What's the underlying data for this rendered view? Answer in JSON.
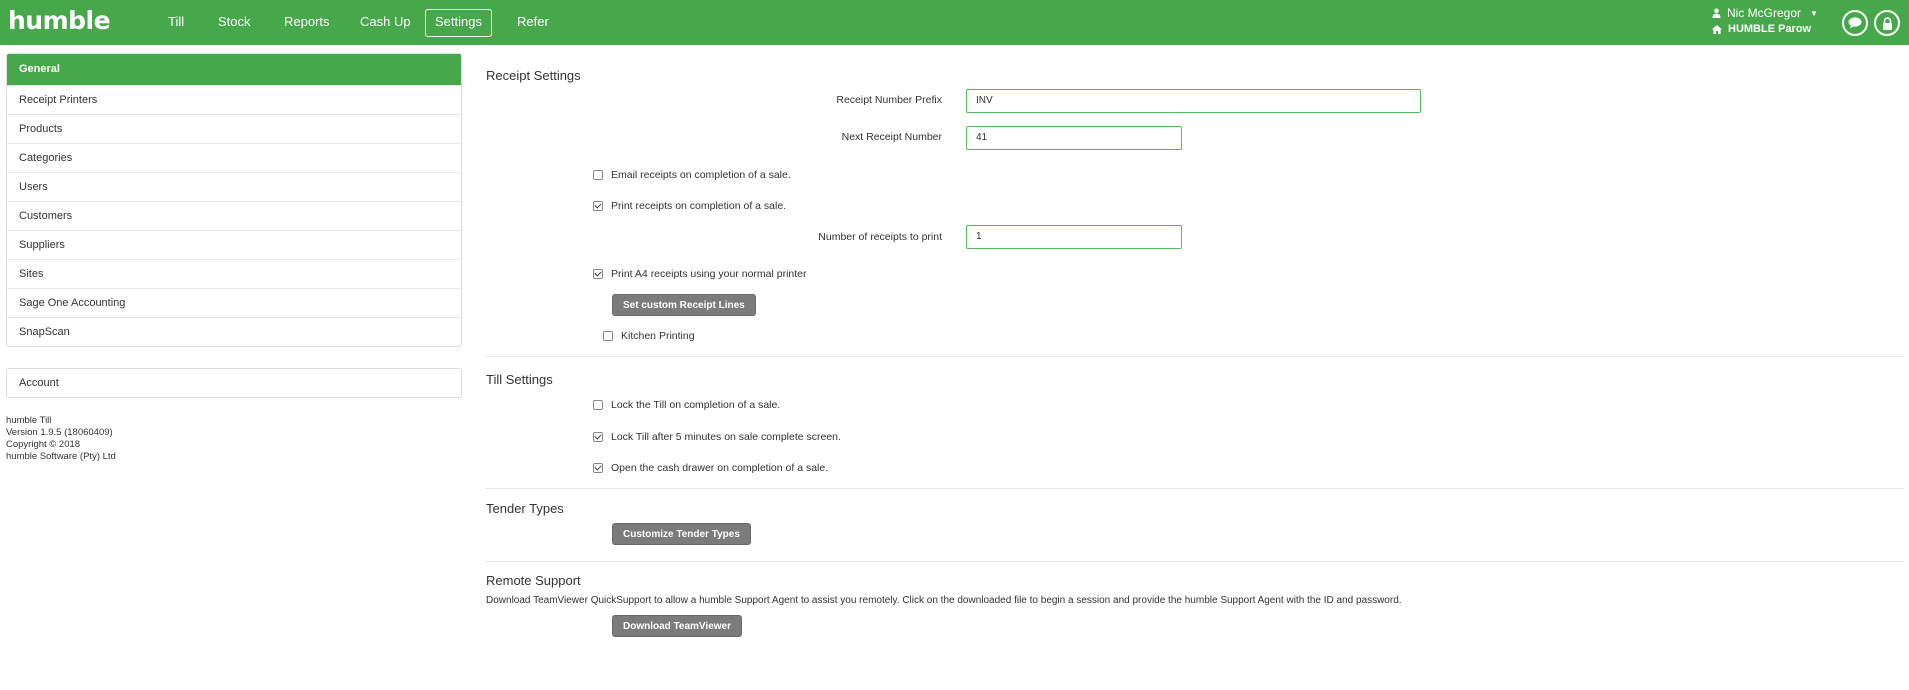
{
  "app": {
    "logo": "humble",
    "nav": [
      "Till",
      "Stock",
      "Reports",
      "Cash Up",
      "Settings",
      "Refer"
    ],
    "active_nav": "Settings",
    "user": {
      "name": "Nic McGregor",
      "site": "HUMBLE Parow"
    },
    "accent_color": "#46a84b"
  },
  "sidebar": {
    "items": [
      "General",
      "Receipt Printers",
      "Products",
      "Categories",
      "Users",
      "Customers",
      "Suppliers",
      "Sites",
      "Sage One Accounting",
      "SnapScan"
    ],
    "active": "General",
    "account": "Account",
    "info": [
      "humble Till",
      "Version 1.9.5 (18060409)",
      "Copyright © 2018",
      "humble Software (Pty) Ltd"
    ]
  },
  "receipt_settings": {
    "title": "Receipt Settings",
    "prefix_label": "Receipt Number Prefix",
    "prefix_value": "INV",
    "next_label": "Next Receipt Number",
    "next_value": "41",
    "email_label": "Email receipts on completion of a sale.",
    "email_checked": false,
    "print_label": "Print receipts on completion of a sale.",
    "print_checked": true,
    "count_label": "Number of receipts to print",
    "count_value": "1",
    "a4_label": "Print A4 receipts using your normal printer",
    "a4_checked": true,
    "custom_lines_button": "Set custom Receipt Lines",
    "kitchen_label": "Kitchen Printing",
    "kitchen_checked": false
  },
  "till_settings": {
    "title": "Till Settings",
    "lock_label": "Lock the Till on completion of a sale.",
    "lock_checked": false,
    "lock5_label": "Lock Till after 5 minutes on sale complete screen.",
    "lock5_checked": true,
    "drawer_label": "Open the cash drawer on completion of a sale.",
    "drawer_checked": true
  },
  "tender_types": {
    "title": "Tender Types",
    "button": "Customize Tender Types"
  },
  "remote_support": {
    "title": "Remote Support",
    "description": "Download TeamViewer QuickSupport to allow a humble Support Agent to assist you remotely. Click on the downloaded file to begin a session and provide the humble Support Agent with the ID and password.",
    "button": "Download TeamViewer"
  }
}
